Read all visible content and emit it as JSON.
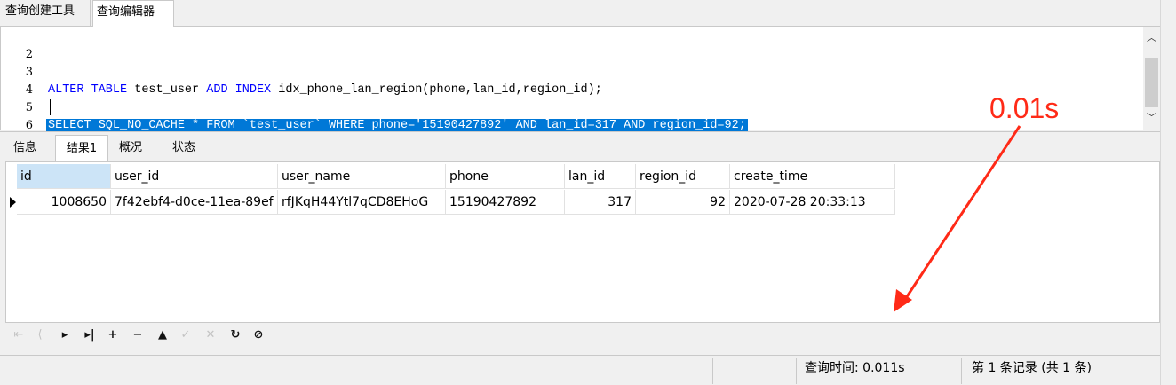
{
  "top_tabs": [
    "查询创建工具",
    "查询编辑器"
  ],
  "editor": {
    "lines": [
      {
        "num": "2",
        "text": ""
      },
      {
        "num": "3",
        "parts": [
          {
            "t": "ALTER TABLE",
            "kw": true
          },
          {
            "t": " test_user ",
            "kw": false
          },
          {
            "t": "ADD INDEX",
            "kw": true
          },
          {
            "t": " idx_phone_lan_region(phone,lan_id,region_id);",
            "kw": false
          }
        ]
      },
      {
        "num": "4",
        "text": ""
      },
      {
        "num": "5",
        "selected_text": "SELECT SQL_NO_CACHE * FROM `test_user` WHERE phone='15190427892' AND lan_id=317 AND region_id=92;"
      },
      {
        "num": "6",
        "text": ""
      }
    ]
  },
  "result_tabs": [
    "信息",
    "结果1",
    "概况",
    "状态"
  ],
  "active_result_tab": "结果1",
  "table": {
    "columns": [
      "id",
      "user_id",
      "user_name",
      "phone",
      "lan_id",
      "region_id",
      "create_time"
    ],
    "rows": [
      [
        "1008650",
        "7f42ebf4-d0ce-11ea-89ef",
        "rfJKqH44Ytl7qCD8EHoG",
        "15190427892",
        "317",
        "92",
        "2020-07-28 20:33:13"
      ]
    ]
  },
  "toolbar_icons": [
    "first-icon",
    "prev-icon",
    "next-icon",
    "last-icon",
    "add-icon",
    "delete-icon",
    "apply-icon",
    "cancel-icon",
    "clear-icon",
    "refresh-icon",
    "stop-icon"
  ],
  "status": {
    "query_time": "查询时间: 0.011s",
    "record_info": "第 1 条记录 (共 1 条)"
  },
  "annotation": {
    "label": "0.01s",
    "color": "#ff2a17"
  },
  "colors": {
    "keyword": "#0000ff",
    "selection": "#0078d7",
    "header_highlight": "#cce4f7"
  }
}
